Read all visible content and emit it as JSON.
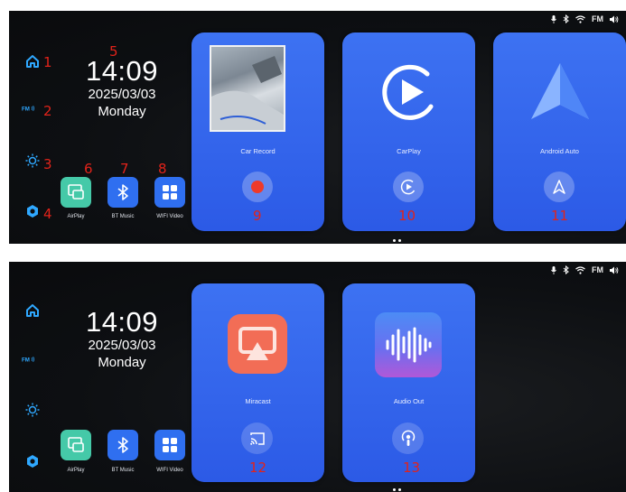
{
  "screens": [
    {
      "status_icons": [
        "mic-icon",
        "bluetooth-icon",
        "wifi-icon",
        "fm-indicator-icon",
        "volume-icon"
      ],
      "status_fm": "FM",
      "sidebar": [
        "home-icon",
        "fm-radio-icon",
        "brightness-icon",
        "settings-icon"
      ],
      "fm_label": "FM",
      "clock": {
        "time": "14:09",
        "date": "2025/03/03",
        "day": "Monday"
      },
      "apps": [
        {
          "label": "AirPlay",
          "color": "#45c9a8",
          "icon": "airplay-icon"
        },
        {
          "label": "BT Music",
          "color": "#2f6ff0",
          "icon": "bluetooth-icon"
        },
        {
          "label": "WIFI Video",
          "color": "#2f6ff0",
          "icon": "grid-icon"
        }
      ],
      "cards": [
        {
          "label": "Car Record",
          "button_icon": "record-icon",
          "thumb": "camera-preview"
        },
        {
          "label": "CarPlay",
          "button_icon": "play-icon",
          "big_icon": "carplay-logo-icon"
        },
        {
          "label": "Android Auto",
          "button_icon": "android-auto-icon",
          "big_icon": "android-auto-logo-icon"
        }
      ],
      "callouts": [
        "1",
        "2",
        "3",
        "4",
        "5",
        "6",
        "7",
        "8",
        "9",
        "10",
        "11"
      ]
    },
    {
      "status_icons": [
        "mic-icon",
        "bluetooth-icon",
        "wifi-icon",
        "fm-indicator-icon",
        "volume-icon"
      ],
      "status_fm": "FM",
      "sidebar": [
        "home-icon",
        "fm-radio-icon",
        "brightness-icon",
        "settings-icon"
      ],
      "fm_label": "FM",
      "clock": {
        "time": "14:09",
        "date": "2025/03/03",
        "day": "Monday"
      },
      "apps": [
        {
          "label": "AirPlay",
          "color": "#45c9a8",
          "icon": "airplay-icon"
        },
        {
          "label": "BT Music",
          "color": "#2f6ff0",
          "icon": "bluetooth-icon"
        },
        {
          "label": "WIFI Video",
          "color": "#2f6ff0",
          "icon": "grid-icon"
        }
      ],
      "cards": [
        {
          "label": "Miracast",
          "button_icon": "cast-icon",
          "big_icon": "miracast-logo-icon",
          "big_color": "#f26d56"
        },
        {
          "label": "Audio Out",
          "button_icon": "podcast-icon",
          "big_icon": "audio-out-logo-icon",
          "big_color": "#6a6ff0"
        }
      ],
      "callouts": [
        "12",
        "13"
      ]
    }
  ],
  "colors": {
    "accent": "#3d72f2",
    "callout": "#e2231a",
    "record": "#ee3a2a",
    "sidebar_icon": "#2fa8ff"
  }
}
